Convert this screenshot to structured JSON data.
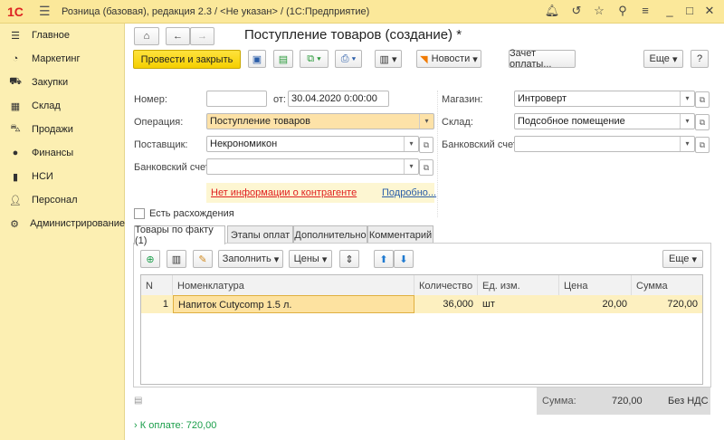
{
  "app": {
    "logo": "1С",
    "title": "Розница (базовая), редакция 2.3 / <Не указан> /  (1С:Предприятие)",
    "icons": [
      "bell-icon",
      "history-icon",
      "star-icon",
      "search-icon",
      "menu-icon",
      "minimize-icon",
      "maximize-icon",
      "close-icon"
    ]
  },
  "sidebar": {
    "items": [
      {
        "label": "Главное",
        "icon": "menu-icon"
      },
      {
        "label": "Маркетинг",
        "icon": "pie-icon"
      },
      {
        "label": "Закупки",
        "icon": "truck-icon"
      },
      {
        "label": "Склад",
        "icon": "warehouse-icon"
      },
      {
        "label": "Продажи",
        "icon": "cart-icon"
      },
      {
        "label": "Финансы",
        "icon": "coins-icon"
      },
      {
        "label": "НСИ",
        "icon": "book-icon"
      },
      {
        "label": "Персонал",
        "icon": "person-icon"
      },
      {
        "label": "Администрирование",
        "icon": "gear-icon"
      }
    ]
  },
  "doc": {
    "title": "Поступление товаров (создание) *"
  },
  "toolbar": {
    "post_close": "Провести и закрыть",
    "news": "Новости",
    "payment_offset": "Зачет оплаты...",
    "more": "Еще",
    "help": "?"
  },
  "form": {
    "number_label": "Номер:",
    "number_value": "",
    "date_label": "от:",
    "date_value": "30.04.2020  0:00:00",
    "operation_label": "Операция:",
    "operation_value": "Поступление товаров",
    "supplier_label": "Поставщик:",
    "supplier_value": "Некрономикон",
    "bank_label": "Банковский счет:",
    "bank_value": "",
    "info_warning": "Нет информации о контрагенте",
    "info_more": "Подробно...",
    "discrepancy_label": "Есть расхождения",
    "discrepancy_checked": false,
    "store_label": "Магазин:",
    "store_value": "Интроверт",
    "warehouse_label": "Склад:",
    "warehouse_value": "Подсобное помещение",
    "store_bank_label": "Банковский счет:",
    "store_bank_value": ""
  },
  "tabs": [
    {
      "label": "Товары по факту (1)",
      "active": true
    },
    {
      "label": "Этапы оплат"
    },
    {
      "label": "Дополнительно"
    },
    {
      "label": "Комментарий"
    }
  ],
  "table_toolbar": {
    "fill": "Заполнить",
    "prices": "Цены",
    "more": "Еще"
  },
  "table": {
    "columns": [
      "N",
      "Номенклатура",
      "Количество",
      "Ед. изм.",
      "Цена",
      "Сумма"
    ],
    "rows": [
      [
        "1",
        "Напиток Cutycomp 1.5 л.",
        "36,000",
        "шт",
        "20,00",
        "720,00"
      ]
    ]
  },
  "totals": {
    "sum_label": "Сумма:",
    "sum_value": "720,00",
    "vat": "Без НДС"
  },
  "footer": {
    "to_pay": "К оплате: 720,00"
  },
  "colors": {
    "accent_yellow": "#f5cf00",
    "sidebar": "#fcefb2",
    "link_green": "#1a9e4a",
    "warning_red": "#e02020"
  }
}
